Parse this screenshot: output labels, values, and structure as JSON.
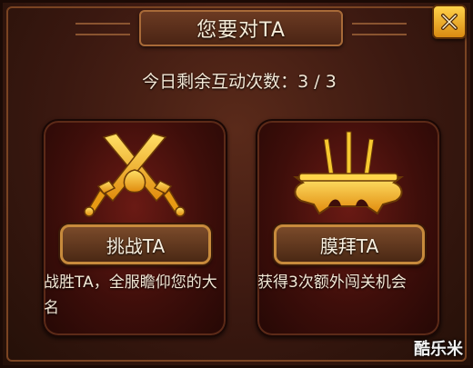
{
  "dialog": {
    "title": "您要对TA",
    "counter_text": "今日剩余互动次数：3 / 3",
    "close_icon": "close-icon"
  },
  "options": [
    {
      "icon": "crossed-swords-icon",
      "button_label": "挑战TA",
      "description": "战胜TA，全服瞻仰您的大名"
    },
    {
      "icon": "incense-burner-icon",
      "button_label": "膜拜TA",
      "description": "获得3次额外闯关机会"
    }
  ],
  "watermark": "酷乐米",
  "colors": {
    "accent_gold": "#f5b11a",
    "panel_red": "#5a1410",
    "title_text": "#f6ecd8"
  }
}
